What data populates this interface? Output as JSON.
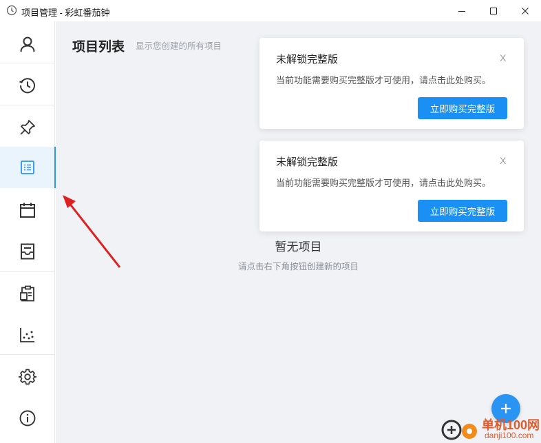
{
  "window": {
    "title": "项目管理 - 彩虹番茄钟",
    "icon": "clock-icon"
  },
  "sidebar": {
    "items": [
      {
        "name": "user",
        "icon": "user-icon",
        "active": false
      },
      {
        "name": "history",
        "icon": "history-clock-icon",
        "active": false
      },
      {
        "name": "pin",
        "icon": "pin-icon",
        "active": false
      },
      {
        "name": "projects",
        "icon": "list-icon",
        "active": true
      },
      {
        "name": "calendar",
        "icon": "calendar-icon",
        "active": false
      },
      {
        "name": "archive",
        "icon": "archive-icon",
        "active": false
      },
      {
        "name": "clipboard",
        "icon": "clipboard-icon",
        "active": false
      },
      {
        "name": "statistics",
        "icon": "scatter-chart-icon",
        "active": false
      },
      {
        "name": "settings",
        "icon": "gear-icon",
        "active": false
      },
      {
        "name": "about",
        "icon": "info-icon",
        "active": false
      }
    ],
    "accent": "#2b93f0"
  },
  "main": {
    "title": "项目列表",
    "subtitle": "显示您创建的所有项目",
    "empty_title": "暂无项目",
    "empty_hint": "请点击右下角按钮创建新的项目"
  },
  "notifications": [
    {
      "title": "未解锁完整版",
      "message": "当前功能需要购买完整版才可使用，请点击此处购买。",
      "close": "X",
      "button": "立即购买完整版"
    },
    {
      "title": "未解锁完整版",
      "message": "当前功能需要购买完整版才可使用，请点击此处购买。",
      "close": "X",
      "button": "立即购买完整版"
    }
  ],
  "fab": {
    "icon": "plus-icon",
    "color": "#2a94f2"
  },
  "watermark": {
    "line1": "单机100网",
    "line2": "danji100.com"
  }
}
